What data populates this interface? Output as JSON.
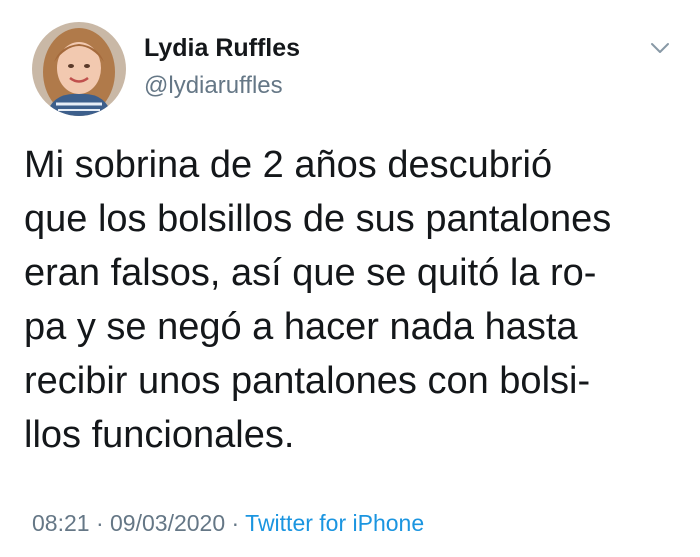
{
  "author": {
    "name": "Lydia Ruffles",
    "handle": "@lydiaruffles"
  },
  "tweet": {
    "lines": [
      "Mi sobrina de 2 años descubrió",
      "que los bolsillos de sus pantalones",
      "eran falsos, así que se quitó la ro-",
      "pa y se negó a hacer nada hasta",
      "recibir unos pantalones con bolsi-",
      "llos funcionales."
    ]
  },
  "meta": {
    "time": "08:21",
    "separator1": " · ",
    "date": "09/03/2020",
    "separator2": " · ",
    "source": "Twitter for iPhone"
  },
  "icons": {
    "menu": "chevron-down-icon"
  },
  "colors": {
    "text": "#14171a",
    "secondary": "#657786",
    "link": "#1b95e0"
  }
}
